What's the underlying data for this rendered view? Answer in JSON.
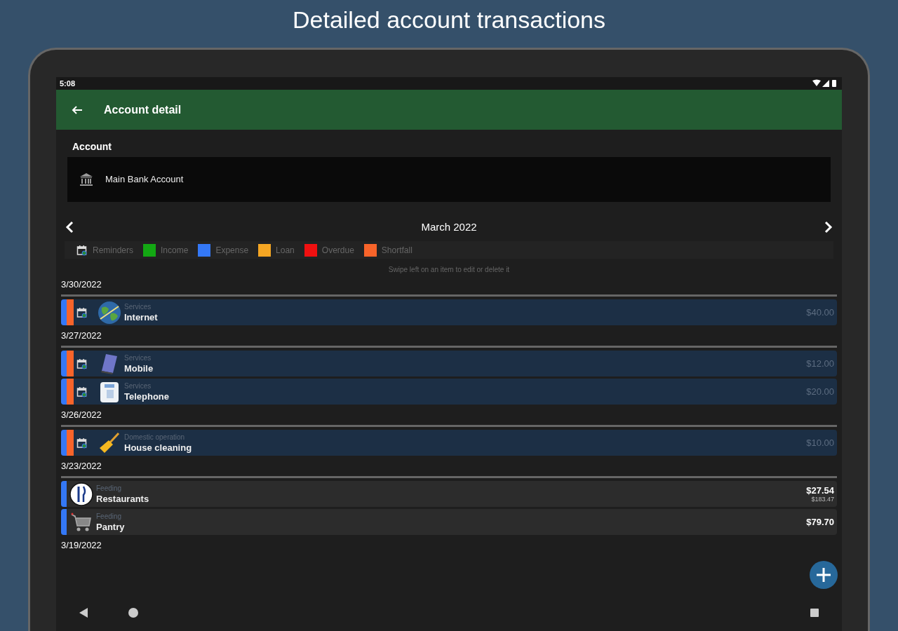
{
  "headline": "Detailed account transactions",
  "status_bar": {
    "time": "5:08"
  },
  "toolbar": {
    "title": "Account detail"
  },
  "account": {
    "label": "Account",
    "name": "Main Bank Account"
  },
  "month": "March 2022",
  "legend": [
    {
      "kind": "reminder",
      "label": "Reminders"
    },
    {
      "kind": "color",
      "label": "Income",
      "color": "#13a813"
    },
    {
      "kind": "color",
      "label": "Expense",
      "color": "#3478f6"
    },
    {
      "kind": "color",
      "label": "Loan",
      "color": "#f5a623"
    },
    {
      "kind": "color",
      "label": "Overdue",
      "color": "#f01010"
    },
    {
      "kind": "color",
      "label": "Shortfall",
      "color": "#f8642a"
    }
  ],
  "hint": "Swipe left on an item to edit or delete it",
  "groups": [
    {
      "date": "3/30/2022",
      "items": [
        {
          "category": "Services",
          "name": "Internet",
          "amount": "$40.00",
          "color": "#3478f6",
          "reminder": true,
          "shortfall": true
        }
      ]
    },
    {
      "date": "3/27/2022",
      "items": [
        {
          "category": "Services",
          "name": "Mobile",
          "amount": "$12.00",
          "color": "#3478f6",
          "reminder": true,
          "shortfall": true
        },
        {
          "category": "Services",
          "name": "Telephone",
          "amount": "$20.00",
          "color": "#3478f6",
          "reminder": true,
          "shortfall": true
        }
      ]
    },
    {
      "date": "3/26/2022",
      "items": [
        {
          "category": "Domestic operation",
          "name": "House cleaning",
          "amount": "$10.00",
          "color": "#3478f6",
          "reminder": true,
          "shortfall": true
        }
      ]
    },
    {
      "date": "3/23/2022",
      "items": [
        {
          "category": "Feeding",
          "name": "Restaurants",
          "amount": "$27.54",
          "balance": "$183.47",
          "color": "#3478f6",
          "reminder": false,
          "shortfall": false
        },
        {
          "category": "Feeding",
          "name": "Pantry",
          "amount": "$79.70",
          "color": "#3478f6",
          "reminder": false,
          "shortfall": false
        }
      ]
    },
    {
      "date": "3/19/2022"
    }
  ]
}
